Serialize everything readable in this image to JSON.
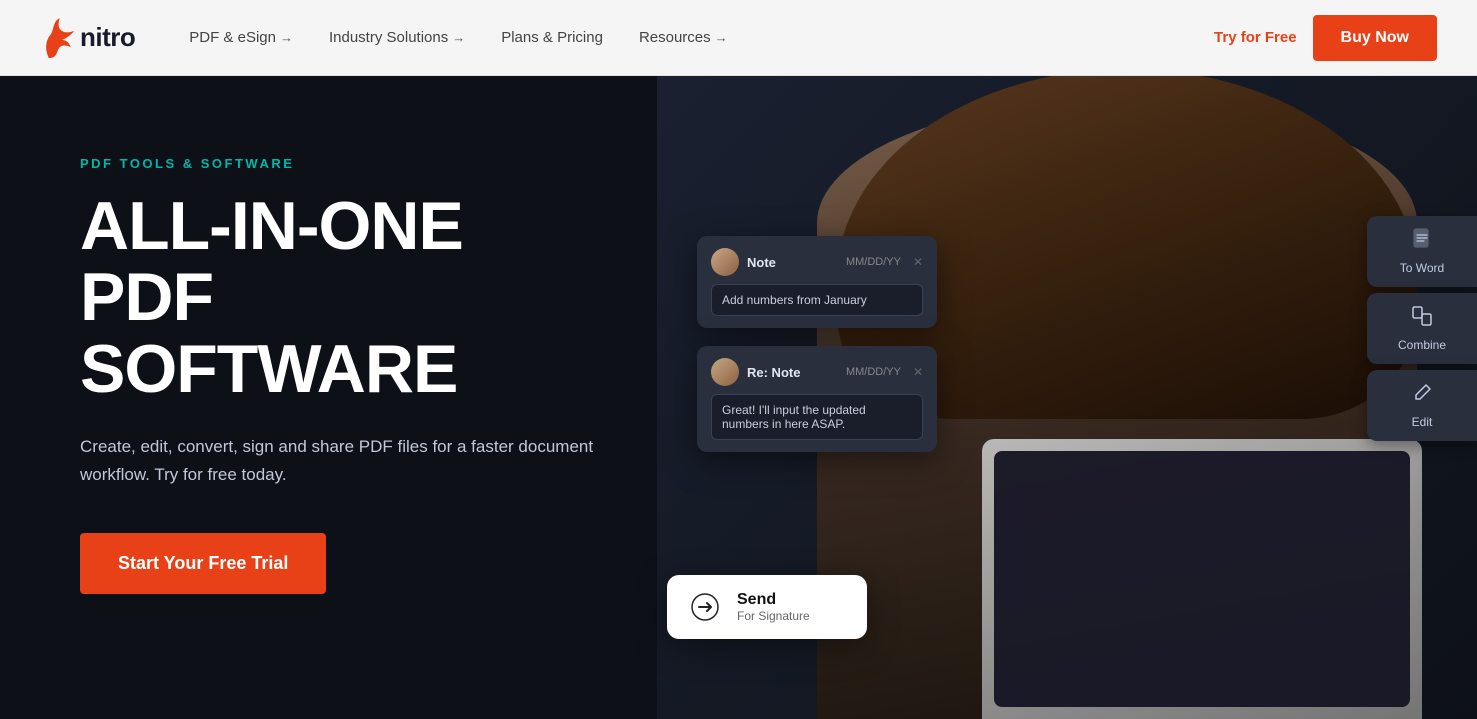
{
  "nav": {
    "logo_text": "nitro",
    "links": [
      {
        "label": "PDF & eSign",
        "arrow": "→",
        "id": "pdf-esign"
      },
      {
        "label": "Industry Solutions",
        "arrow": "→",
        "id": "industry-solutions"
      },
      {
        "label": "Plans & Pricing",
        "arrow": "",
        "id": "plans-pricing"
      },
      {
        "label": "Resources",
        "arrow": "→",
        "id": "resources"
      }
    ],
    "try_free": "Try for Free",
    "buy_now": "Buy Now"
  },
  "hero": {
    "eyebrow": "PDF TOOLS & SOFTWARE",
    "title_line1": "ALL-IN-ONE PDF",
    "title_line2": "SOFTWARE",
    "description": "Create, edit, convert, sign and share PDF files for a faster document workflow. Try for free today.",
    "cta": "Start Your Free Trial"
  },
  "ui_cards": {
    "note1": {
      "label": "Note",
      "date": "MM/DD/YY",
      "content": "Add numbers from January"
    },
    "note2": {
      "label": "Re: Note",
      "date": "MM/DD/YY",
      "content": "Great! I'll input the updated numbers in here ASAP."
    },
    "send": {
      "title": "Send",
      "subtitle": "For Signature"
    },
    "toolbar": [
      {
        "icon": "📄",
        "label": "To Word"
      },
      {
        "icon": "⧉",
        "label": "Combine"
      },
      {
        "icon": "✏️",
        "label": "Edit"
      }
    ]
  },
  "colors": {
    "accent_orange": "#e84118",
    "accent_teal": "#00b8a9",
    "hero_bg": "#0d1117",
    "nav_bg": "#f5f5f5"
  }
}
